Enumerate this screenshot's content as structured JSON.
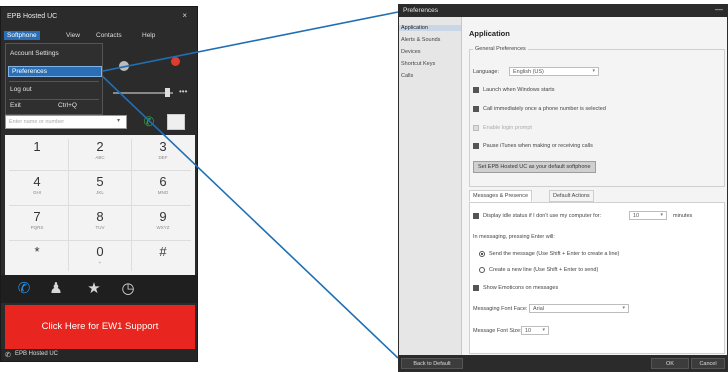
{
  "phone": {
    "title": "EPB Hosted UC",
    "close": "×",
    "menu": [
      "Softphone",
      "View",
      "Contacts",
      "Help"
    ],
    "dropdown": {
      "items": [
        "Account Settings",
        "Preferences",
        "Log out",
        "Exit"
      ],
      "exit_shortcut": "Ctrl+Q",
      "selected_index": 1
    },
    "volume_more": "•••",
    "dial_placeholder": "Enter name or number",
    "dial_caret": "▾",
    "keys": [
      {
        "digit": "1",
        "letters": ""
      },
      {
        "digit": "2",
        "letters": "ABC"
      },
      {
        "digit": "3",
        "letters": "DEF"
      },
      {
        "digit": "4",
        "letters": "GHI"
      },
      {
        "digit": "5",
        "letters": "JKL"
      },
      {
        "digit": "6",
        "letters": "MNO"
      },
      {
        "digit": "7",
        "letters": "PQRS"
      },
      {
        "digit": "8",
        "letters": "TUV"
      },
      {
        "digit": "9",
        "letters": "WXYZ"
      },
      {
        "digit": "*",
        "letters": ""
      },
      {
        "digit": "0",
        "letters": "+"
      },
      {
        "digit": "#",
        "letters": ""
      }
    ],
    "support_label": "Click Here for EW1 Support",
    "footer_label": "EPB Hosted UC"
  },
  "prefs": {
    "title": "Preferences",
    "min": "—",
    "sidebar": [
      "Application",
      "Alerts & Sounds",
      "Devices",
      "Shortcut Keys",
      "Calls"
    ],
    "sidebar_active": 0,
    "heading": "Application",
    "general_label": "General Preferences",
    "language_label": "Language:",
    "language_value": "English (US)",
    "checks": [
      {
        "label": "Launch when Windows starts",
        "checked": true
      },
      {
        "label": "Call immediately once a phone number is selected",
        "checked": true
      },
      {
        "label": "Enable login prompt",
        "checked": false
      },
      {
        "label": "Pause iTunes when making or receiving calls",
        "checked": true
      }
    ],
    "default_btn": "Set EPB Hosted UC as your default softphone",
    "tabs": [
      "Messages & Presence",
      "Default Actions"
    ],
    "idle_label": "Display idle status if I don't use my computer for:",
    "idle_value": "10",
    "idle_unit": "minutes",
    "enter_label": "In messaging, pressing Enter will:",
    "radio_send": "Send the message (Use Shift + Enter to create a line)",
    "radio_newline": "Create a new line (Use Shift + Enter to send)",
    "emoticons": "Show Emoticons on messages",
    "font_face_label": "Messaging Font Face:",
    "font_face_value": "Arial",
    "font_size_label": "Message Font Size:",
    "font_size_value": "10",
    "back_btn": "Back to Default",
    "ok_btn": "OK",
    "cancel_btn": "Cancel"
  }
}
